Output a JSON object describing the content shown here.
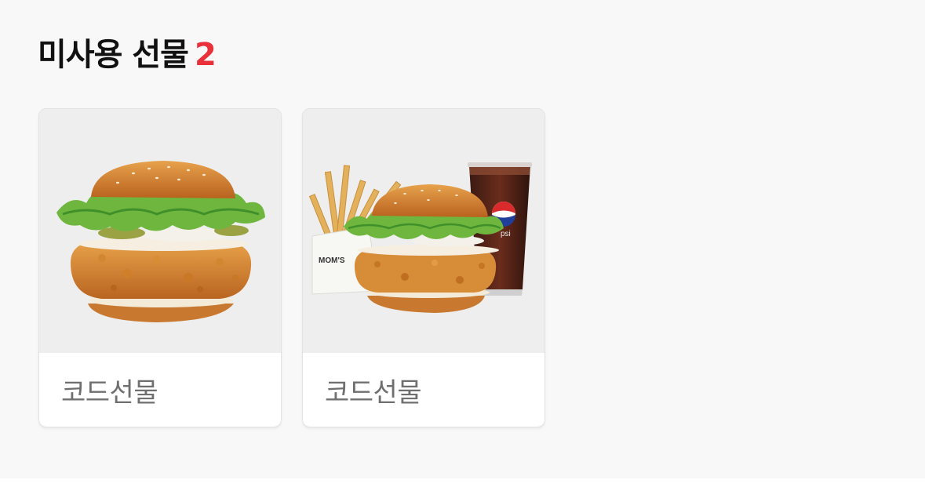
{
  "section": {
    "title": "미사용 선물",
    "count": "2"
  },
  "gifts": [
    {
      "label": "코드선물",
      "image": "chicken-burger-photo"
    },
    {
      "label": "코드선물",
      "image": "burger-set-photo",
      "bag_text": "MOM'S",
      "cup_text": "psi"
    }
  ],
  "colors": {
    "count_accent": "#e8313a",
    "background": "#f8f8f8",
    "card_label": "#6f6f6f"
  }
}
